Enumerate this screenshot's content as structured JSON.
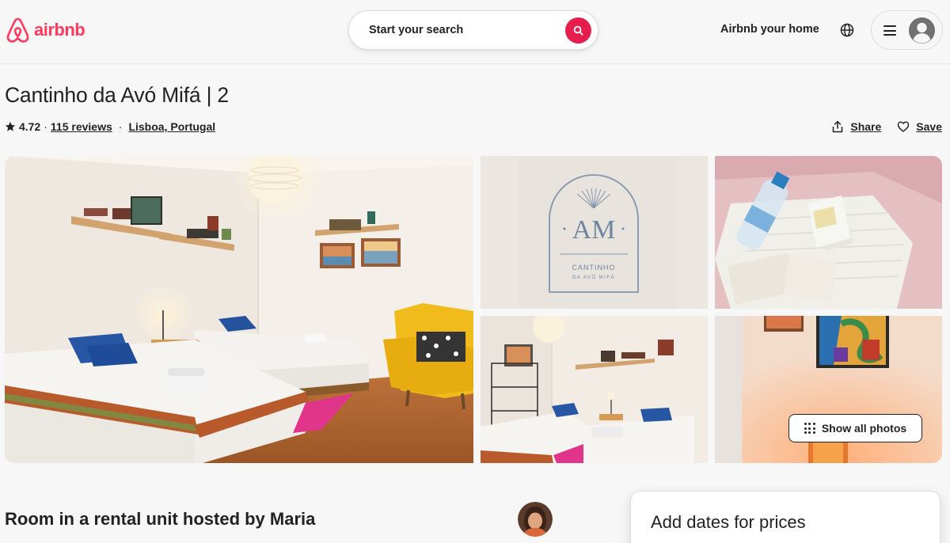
{
  "header": {
    "brand": "airbnb",
    "search_label": "Start your search",
    "host_link": "Airbnb your home"
  },
  "listing": {
    "title": "Cantinho da Avó Mifá | 2",
    "rating": "4.72",
    "separator": "·",
    "reviews": "115 reviews",
    "location": "Lisboa, Portugal",
    "share_label": "Share",
    "save_label": "Save"
  },
  "gallery": {
    "show_all_label": "Show all photos",
    "logo_monogram": "AM",
    "logo_line1": "CANTINHO",
    "logo_line2": "DA AVÓ MIFÁ"
  },
  "details": {
    "subtitle": "Room in a rental unit hosted by Maria"
  },
  "booking": {
    "title": "Add dates for prices"
  },
  "colors": {
    "brand": "#ff385c",
    "search_button": "#e61e4d",
    "text": "#222222",
    "background": "#f7f7f7"
  }
}
